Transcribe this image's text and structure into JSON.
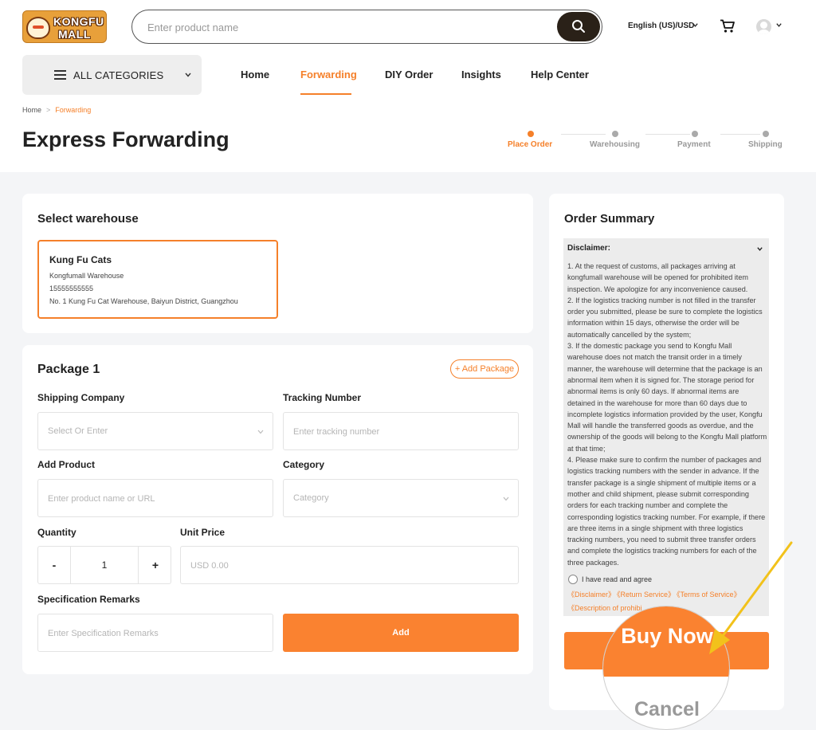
{
  "header": {
    "logo_line1": "KONGFU",
    "logo_line2": "MALL",
    "search_placeholder": "Enter product name",
    "language": "English (US)/USD",
    "icons": [
      "search-icon",
      "cart-icon",
      "avatar-icon",
      "chevron-down-icon"
    ]
  },
  "nav": {
    "all_categories": "ALL CATEGORIES",
    "items": [
      "Home",
      "Forwarding",
      "DIY Order",
      "Insights",
      "Help Center"
    ],
    "active": "Forwarding"
  },
  "breadcrumb": {
    "home": "Home",
    "separator": ">",
    "current": "Forwarding"
  },
  "page_title": "Express Forwarding",
  "steps": {
    "items": [
      "Place Order",
      "Warehousing",
      "Payment",
      "Shipping"
    ],
    "active": "Place Order"
  },
  "warehouse": {
    "section_title": "Select warehouse",
    "name": "Kung Fu Cats",
    "company": "Kongfumall Warehouse",
    "phone": "15555555555",
    "address": "No. 1 Kung Fu Cat Warehouse, Baiyun District, Guangzhou"
  },
  "package": {
    "title": "Package 1",
    "add_package": "+ Add Package",
    "shipping_company_label": "Shipping Company",
    "shipping_company_placeholder": "Select Or Enter",
    "tracking_label": "Tracking Number",
    "tracking_placeholder": "Enter tracking number",
    "product_label": "Add Product",
    "product_placeholder": "Enter product name or URL",
    "category_label": "Category",
    "category_placeholder": "Category",
    "quantity_label": "Quantity",
    "quantity_minus": "-",
    "quantity_value": "1",
    "quantity_plus": "+",
    "unit_price_label": "Unit Price",
    "unit_price_placeholder": "USD 0.00",
    "remarks_label": "Specification Remarks",
    "remarks_placeholder": "Enter Specification Remarks",
    "add_button": "Add"
  },
  "summary": {
    "title": "Order Summary",
    "disclaimer_title": "Disclaimer:",
    "disclaimer_text": "1. At the request of customs, all packages arriving at kongfumall warehouse will be opened for prohibited item inspection. We apologize for any inconvenience caused.\n2. If the logistics tracking number is not filled in the transfer order you submitted, please be sure to complete the logistics information within 15 days, otherwise the order will be automatically cancelled by the system;\n3. If the domestic package you send to Kongfu Mall warehouse does not match the transit order in a timely manner, the warehouse will determine that the package is an abnormal item when it is signed for. The storage period for abnormal items is only 60 days. If abnormal items are detained in the warehouse for more than 60 days due to incomplete logistics information provided by the user, Kongfu Mall will handle the transferred goods as overdue, and the ownership of the goods will belong to the Kongfu Mall platform at that time;\n4. Please make sure to confirm the number of packages and logistics tracking numbers with the sender in advance. If the transfer package is a single shipment of multiple items or a mother and child shipment, please submit corresponding orders for each tracking number and complete the corresponding logistics tracking number. For example, if there are three items in a single shipment with three logistics tracking numbers, you need to submit three transfer orders and complete the logistics tracking numbers for each of the three packages.",
    "agree_text": "I have read and agree",
    "link_disclaimer": "《Disclaimer》",
    "link_return": "《Return Service》",
    "link_terms": "《Terms of Service》",
    "link_prohibited": "《Description of prohibi",
    "buy_now": "Buy Now",
    "cancel": "Cancel"
  },
  "colors": {
    "accent": "#f5802a",
    "button": "#fa8230",
    "search_button": "#2a2118",
    "annotation_arrow": "#f2c21b"
  }
}
